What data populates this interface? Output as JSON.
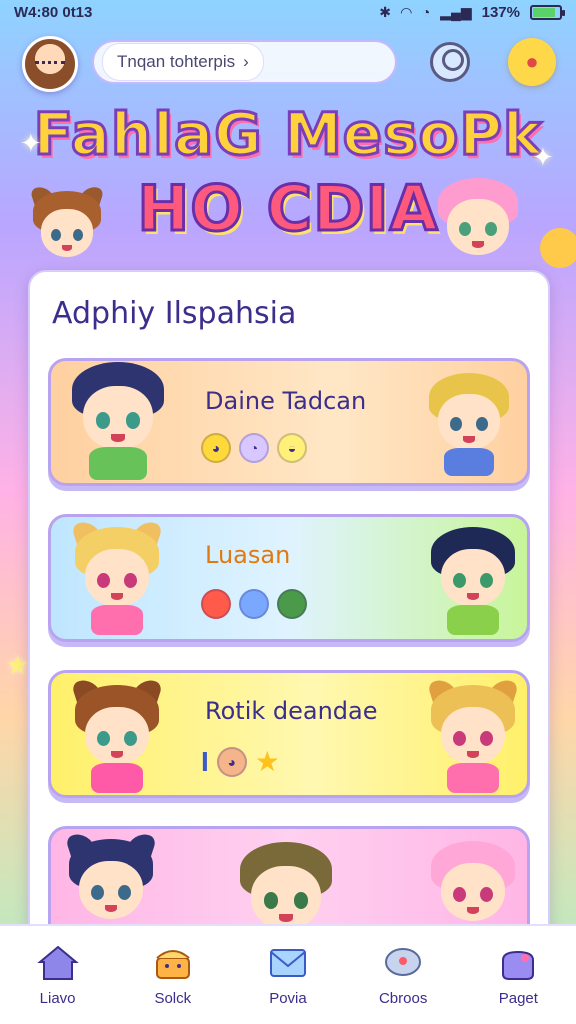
{
  "status_bar": {
    "time": "W4:80 0t13",
    "battery_text": "137%",
    "battery_level": 0.85
  },
  "header": {
    "search_text": "Tnqan tohterpis",
    "search_arrow": "›"
  },
  "logo": {
    "line1": "FahlaG MesoPk",
    "line2": "HO CDIA"
  },
  "section": {
    "title": "Adphiy Ilspahsia"
  },
  "cards": [
    {
      "label": "Daine Tadcan",
      "icons": [
        "◕",
        "◔",
        "◒"
      ]
    },
    {
      "label": "Luasan",
      "icons": [
        "●",
        "●",
        "●"
      ]
    },
    {
      "label": "Rotik deandae",
      "icons": [
        "I",
        "◕",
        "★"
      ]
    },
    {
      "label": "",
      "icons": []
    }
  ],
  "nav": [
    {
      "label": "Liavo",
      "icon": "home-icon"
    },
    {
      "label": "Solck",
      "icon": "shop-icon"
    },
    {
      "label": "Povia",
      "icon": "mail-icon"
    },
    {
      "label": "Cbroos",
      "icon": "chat-icon"
    },
    {
      "label": "Paget",
      "icon": "bag-icon"
    }
  ],
  "colors": {
    "accent": "#3b2e8c",
    "card1": "#ffd9b0",
    "card2": "#bfe8ff",
    "card3": "#fff27a",
    "card4": "#ffc0ea"
  }
}
